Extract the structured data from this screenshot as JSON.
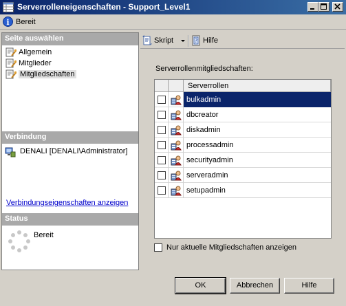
{
  "window": {
    "title": "Serverrolleneigenschaften - Support_Level1"
  },
  "status_strip": {
    "text": "Bereit",
    "icon": "info-icon"
  },
  "left": {
    "select_page_heading": "Seite auswählen",
    "pages": [
      {
        "label": "Allgemein",
        "icon": "page-wrench-icon",
        "selected": false
      },
      {
        "label": "Mitglieder",
        "icon": "page-wrench-icon",
        "selected": false
      },
      {
        "label": "Mitgliedschaften",
        "icon": "page-wrench-icon",
        "selected": true
      }
    ],
    "connection_heading": "Verbindung",
    "connection_text": "DENALI [DENALI\\Administrator]",
    "connection_link": "Verbindungseigenschaften anzeigen",
    "status_heading": "Status",
    "status_value": "Bereit"
  },
  "toolbar": {
    "script_label": "Skript",
    "help_label": "Hilfe"
  },
  "main": {
    "roles_label": "Serverrollenmitgliedschaften:",
    "column_header": "Serverrollen",
    "roles": [
      {
        "name": "bulkadmin",
        "checked": false,
        "selected": true
      },
      {
        "name": "dbcreator",
        "checked": false,
        "selected": false
      },
      {
        "name": "diskadmin",
        "checked": false,
        "selected": false
      },
      {
        "name": "processadmin",
        "checked": false,
        "selected": false
      },
      {
        "name": "securityadmin",
        "checked": false,
        "selected": false
      },
      {
        "name": "serveradmin",
        "checked": false,
        "selected": false
      },
      {
        "name": "setupadmin",
        "checked": false,
        "selected": false
      }
    ],
    "only_current_label": "Nur aktuelle Mitgliedschaften anzeigen"
  },
  "buttons": {
    "ok": "OK",
    "cancel": "Abbrechen",
    "help": "Hilfe"
  },
  "colors": {
    "titlebar": "#0a246a",
    "selection": "#0a246a",
    "section_header": "#a9a9a9"
  }
}
